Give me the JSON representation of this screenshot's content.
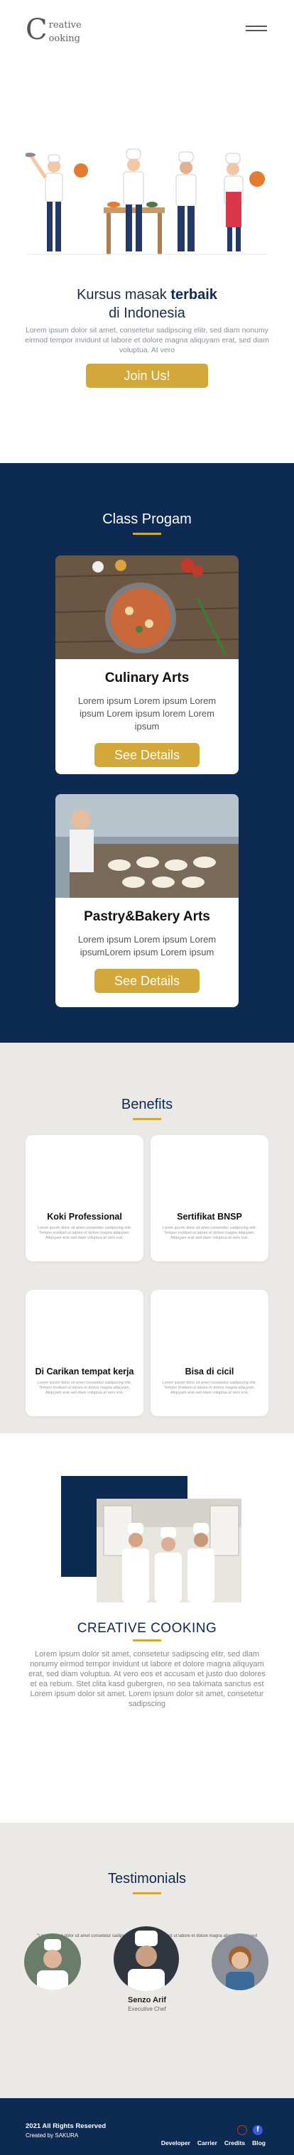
{
  "header": {
    "logo_letter": "C",
    "logo_word1": "reative",
    "logo_word2": "ooking",
    "menu_icon": "hamburger-icon"
  },
  "hero": {
    "title_prefix": "Kursus masak ",
    "title_bold": "terbaik",
    "subtitle": "di Indonesia",
    "description": "Lorem ipsum dolor sit amet, consetetur sadipscing elitr, sed diam nonumy eirmod tempor invidunt ut labore et dolore magna aliquyam erat, sed diam voluptua. At vero",
    "cta": "Join Us!"
  },
  "classes": {
    "title": "Class Progam",
    "items": [
      {
        "title": "Culinary Arts",
        "text": "Lorem ipsum Lorem ipsum Lorem ipsum Lorem ipsum lorem Lorem ipsum",
        "button": "See Details"
      },
      {
        "title": "Pastry&Bakery Arts",
        "text": "Lorem ipsum Lorem ipsum Lorem ipsumLorem ipsum Lorem ipsum",
        "button": "See Details"
      }
    ]
  },
  "benefits": {
    "title": "Benefits",
    "items": [
      {
        "title": "Koki Professional",
        "text": "Lorem ipsum dolor sit amet consetetur sadipscing elitr. Tempor invidunt ut labore et dolore magna aliquyam. Aliquyam erat sed diam voluptua at vero eos."
      },
      {
        "title": "Sertifikat BNSP",
        "text": "Lorem ipsum dolor sit amet consetetur sadipscing elitr. Tempor invidunt ut labore et dolore magna aliquyam. Aliquyam erat sed diam voluptua at vero eos."
      },
      {
        "title": "Di Carikan tempat kerja",
        "text": "Lorem ipsum dolor sit amet consetetur sadipscing elitr. Tempor invidunt ut labore et dolore magna aliquyam. Aliquyam erat sed diam voluptua at vero eos."
      },
      {
        "title": "Bisa di cicil",
        "text": "Lorem ipsum dolor sit amet consetetur sadipscing elitr. Tempor invidunt ut labore et dolore magna aliquyam. Aliquyam erat sed diam voluptua at vero eos."
      }
    ]
  },
  "about": {
    "title": "CREATIVE COOKING",
    "text": "Lorem ipsum dolor sit amet, consetetur sadipscing elitr, sed diam nonumy eirmod tempor invidunt ut labore et dolore magna aliquyam erat, sed diam voluptua. At vero eos et accusam et justo duo dolores et ea rebum. Stet clita kasd gubergren, no sea takimata sanctus est Lorem ipsum dolor sit amet. Lorem ipsum dolor sit amet, consetetur sadipscing"
  },
  "testimonials": {
    "title": "Testimonials",
    "quote": "\"Lorem ipsum dolor sit amet consetetur sadipscing elitr. Tempor invidunt ut labore et dolore magna aliquyam erat sed diam voluptua.\"",
    "name": "Senzo Arif",
    "role": "Executive Chef"
  },
  "footer": {
    "copyright": "2021 All Rights Reserved",
    "created_by": "Created by SAKURA",
    "links": [
      "Developer",
      "Carrier",
      "Credits",
      "Blog"
    ],
    "social_icons": [
      "instagram-icon",
      "facebook-icon"
    ]
  },
  "colors": {
    "navy": "#0d2a52",
    "gold": "#d3a83a",
    "light_bg": "#ebe9e6"
  }
}
